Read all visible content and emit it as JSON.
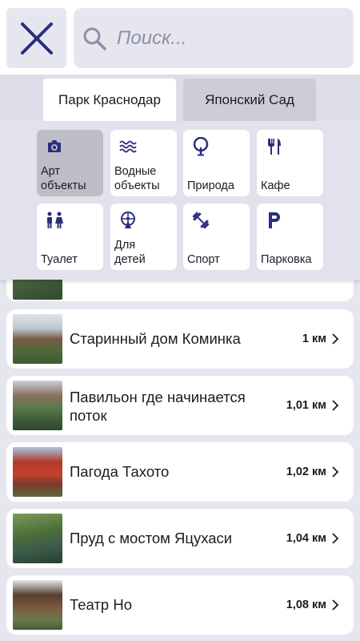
{
  "search": {
    "placeholder": "Поиск..."
  },
  "tabs": [
    {
      "label": "Парк Краснодар",
      "active": true
    },
    {
      "label": "Японский Сад",
      "active": false
    }
  ],
  "categories": [
    {
      "label": "Арт\nобъекты",
      "icon": "camera-icon",
      "selected": true
    },
    {
      "label": "Водные\nобъекты",
      "icon": "water-icon",
      "selected": false
    },
    {
      "label": "Природа",
      "icon": "tree-icon",
      "selected": false
    },
    {
      "label": "Кафе",
      "icon": "cutlery-icon",
      "selected": false
    },
    {
      "label": "Туалет",
      "icon": "restroom-icon",
      "selected": false
    },
    {
      "label": "Для\nдетей",
      "icon": "ferris-wheel-icon",
      "selected": false
    },
    {
      "label": "Спорт",
      "icon": "dumbbell-icon",
      "selected": false
    },
    {
      "label": "Парковка",
      "icon": "parking-icon",
      "selected": false
    }
  ],
  "places": [
    {
      "name": "",
      "distance": ""
    },
    {
      "name": "Старинный дом Коминка",
      "distance": "1 км"
    },
    {
      "name": "Павильон где начинается поток",
      "distance": "1,01 км"
    },
    {
      "name": "Пагода Тахото",
      "distance": "1,02 км"
    },
    {
      "name": "Пруд с мостом Яцухаси",
      "distance": "1,04 км"
    },
    {
      "name": "Театр Но",
      "distance": "1,08 км"
    }
  ],
  "colors": {
    "accent": "#2a2f7a",
    "background": "#e6e6ef",
    "card": "#ffffff",
    "selected_category": "#bdbdc6"
  }
}
